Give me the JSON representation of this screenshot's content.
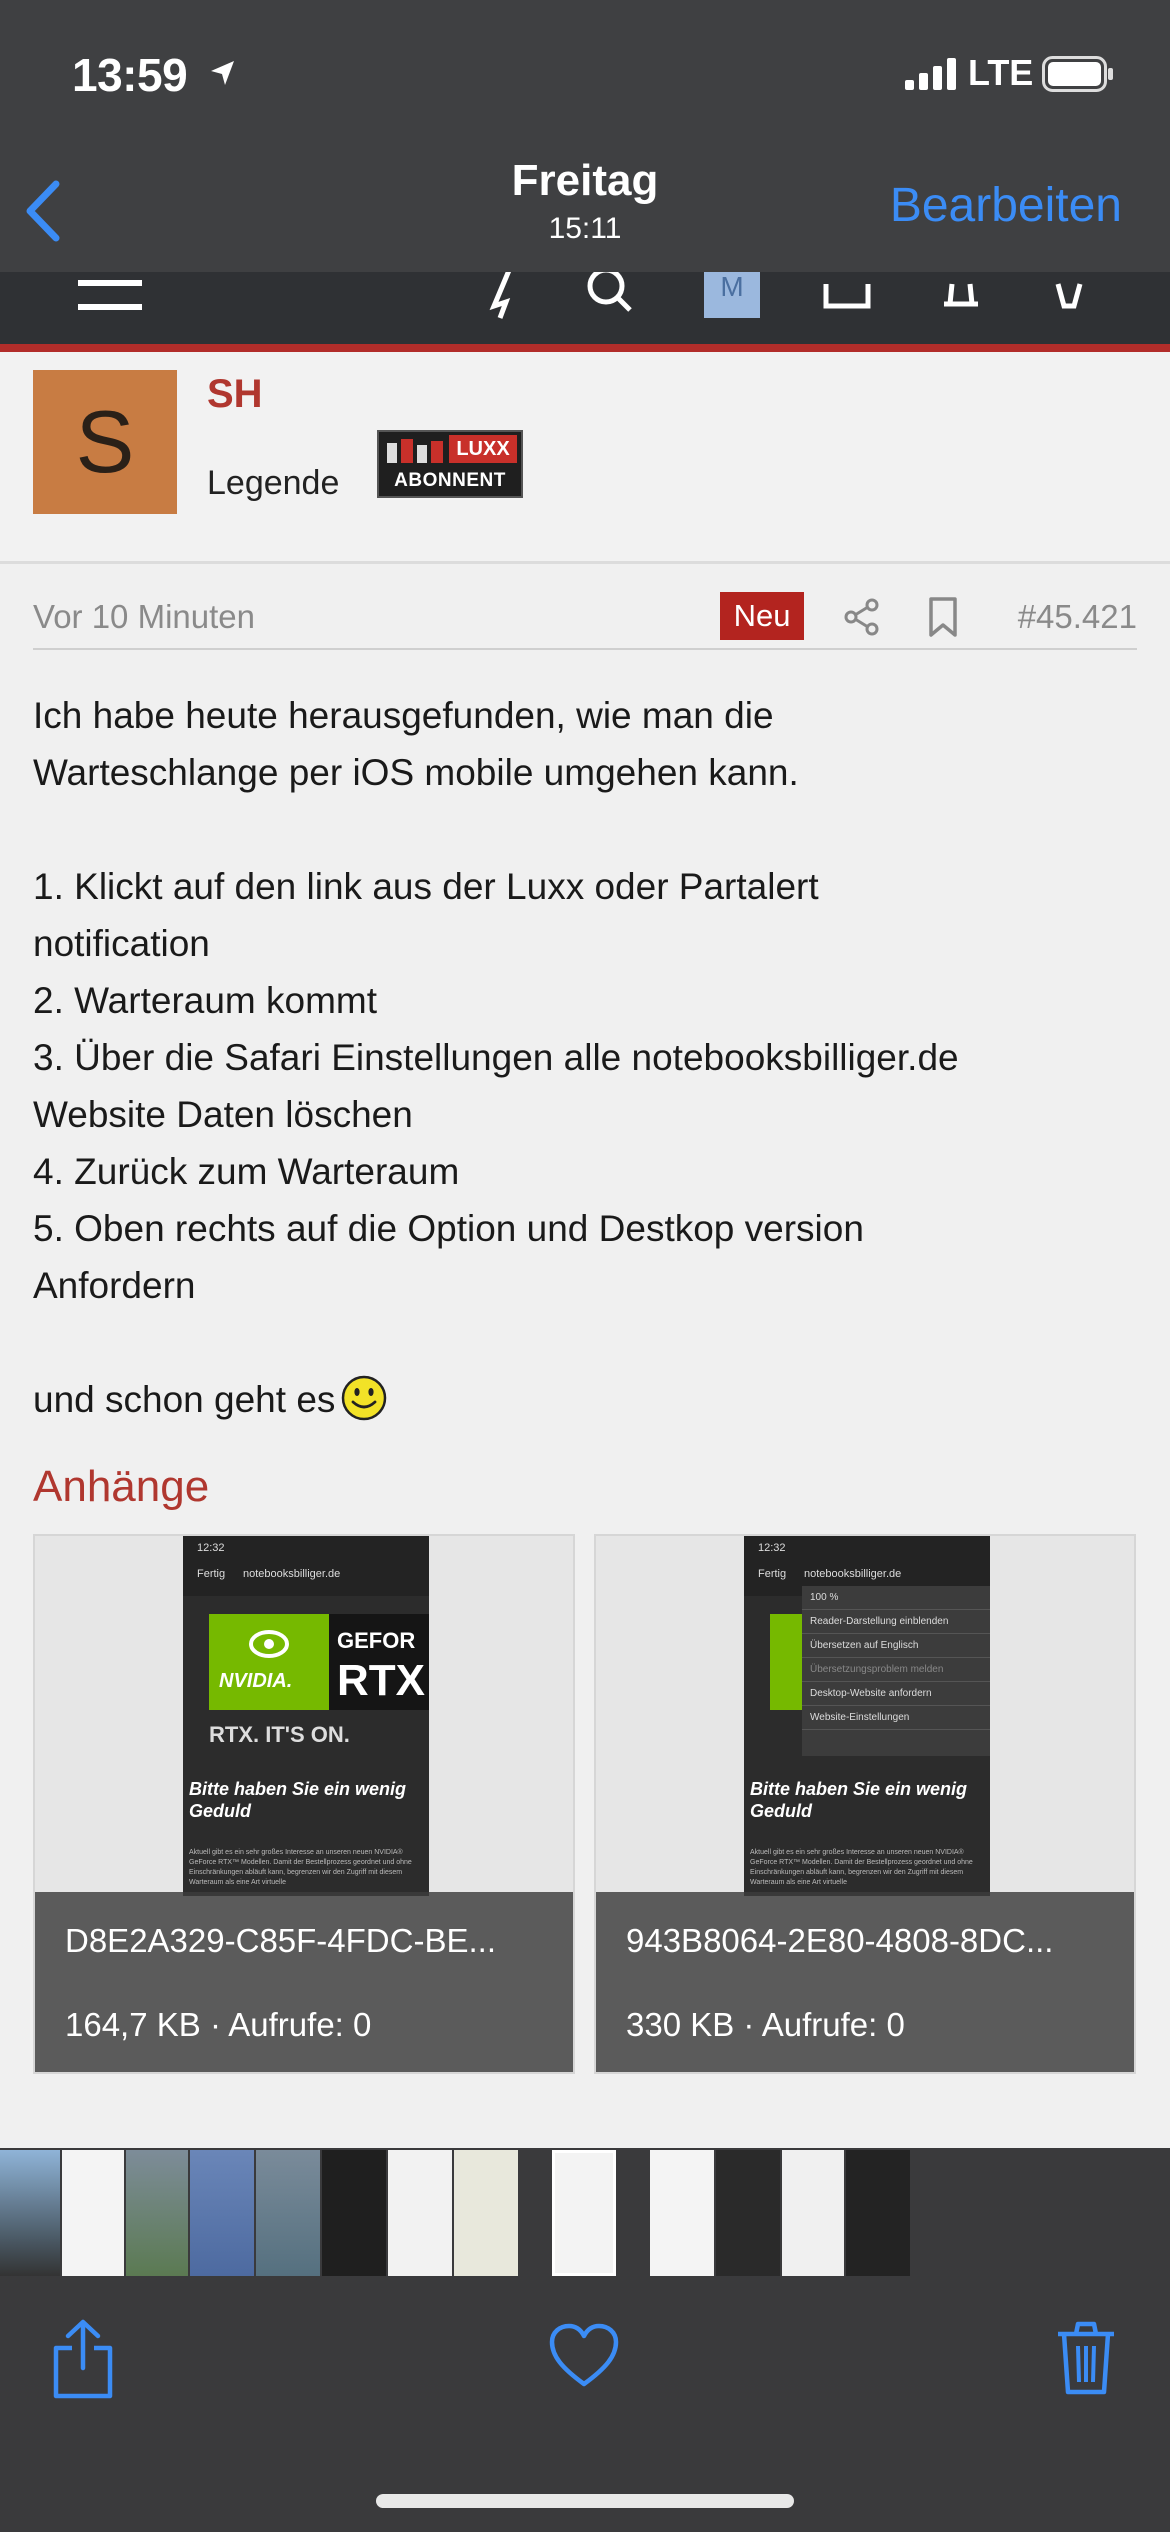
{
  "status_bar": {
    "time": "13:59",
    "network": "LTE"
  },
  "nav": {
    "title": "Freitag",
    "subtitle": "15:11",
    "edit_label": "Bearbeiten"
  },
  "post": {
    "author_initial": "S",
    "author_name": "SH",
    "author_rank": "Legende",
    "badge_top": "LUXX",
    "badge_bottom": "ABONNENT",
    "time_ago": "Vor 10 Minuten",
    "new_label": "Neu",
    "post_number": "#45.421",
    "body_lines": [
      "Ich habe heute herausgefunden, wie man die",
      "Warteschlange per iOS mobile umgehen kann.",
      "",
      "1. Klickt auf den link aus der Luxx oder Partalert",
      "notification",
      "2. Warteraum kommt",
      "3. Über die Safari Einstellungen alle notebooksbilliger.de",
      "Website Daten löschen",
      "4. Zurück zum Warteraum",
      "5. Oben rechts auf die Option und Destkop version",
      "Anfordern",
      "",
      "und schon geht es"
    ]
  },
  "attachments": {
    "title": "Anhänge",
    "items": [
      {
        "name": "D8E2A329-C85F-4FDC-BE...",
        "info": "164,7 KB · Aufrufe: 0",
        "shot_time": "12:32",
        "shot_url": "notebooksbilliger.de",
        "shot_done": "Fertig",
        "shot_brand": "NVIDIA.",
        "shot_geforce": "GEFOR",
        "shot_rtx": "RTX",
        "shot_slogan": "RTX. IT'S ON.",
        "shot_wait": "Bitte haben Sie ein wenig Geduld",
        "shot_small": "Aktuell gibt es ein sehr großes Interesse an unseren neuen NVIDIA® GeForce RTX™ Modellen. Damit der Bestellprozess geordnet und ohne Einschränkungen abläuft kann, begrenzen wir den Zugriff mit diesem Warteraum als eine Art virtuelle"
      },
      {
        "name": "943B8064-2E80-4808-8DC...",
        "info": "330 KB · Aufrufe: 0",
        "shot_time": "12:32",
        "shot_url": "notebooksbilliger.de",
        "shot_done": "Fertig",
        "shot_wait": "Bitte haben Sie ein wenig Geduld",
        "shot_small": "Aktuell gibt es ein sehr großes Interesse an unseren neuen NVIDIA® GeForce RTX™ Modellen. Damit der Bestellprozess geordnet und ohne Einschränkungen abläuft kann, begrenzen wir den Zugriff mit diesem Warteraum als eine Art virtuelle",
        "menu": [
          "100 %",
          "Reader-Darstellung einblenden",
          "Übersetzen auf Englisch",
          "Übersetzungsproblem melden",
          "Desktop-Website anfordern",
          "Website-Einstellungen"
        ]
      }
    ]
  },
  "colors": {
    "accent_red": "#b0372f",
    "ios_blue": "#3b8cf5",
    "new_badge": "#b3241f",
    "nvidia_green": "#76b900"
  }
}
